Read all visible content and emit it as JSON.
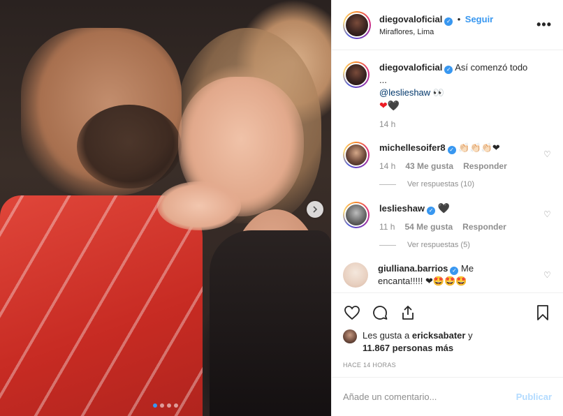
{
  "header": {
    "username": "diegovaloficial",
    "separator": "•",
    "follow_label": "Seguir",
    "location": "Miraflores, Lima",
    "more_label": "•••"
  },
  "caption": {
    "username": "diegovaloficial",
    "text": "Así comenzó todo ...",
    "mention": "@leslieshaw",
    "eyes": "👀",
    "hearts": [
      "❤",
      "🖤"
    ],
    "time": "14 h"
  },
  "comments": [
    {
      "username": "michellesoifer8",
      "emojis": "👏🏻👏🏻👏🏻❤",
      "time": "14 h",
      "likes": "43 Me gusta",
      "reply_label": "Responder",
      "replies": "Ver respuestas (10)"
    },
    {
      "username": "leslieshaw",
      "emojis": "🖤",
      "time": "11 h",
      "likes": "54 Me gusta",
      "reply_label": "Responder",
      "replies": "Ver respuestas (5)"
    },
    {
      "username": "giulliana.barrios",
      "text_1": "Me",
      "text_2": "encanta!!!!!",
      "emojis": "❤🤩🤩🤩"
    }
  ],
  "likes": {
    "prefix": "Les gusta a",
    "user": "ericksabater",
    "conj": "y",
    "count": "11.867 personas más"
  },
  "post_time": "HACE 14 HORAS",
  "add_comment": {
    "placeholder": "Añade un comentario...",
    "publish_label": "Publicar"
  },
  "carousel": {
    "total_dots": 4,
    "active_dot": 0
  },
  "colors": {
    "accent": "#3897f0",
    "publish_disabled": "#b3dbff",
    "muted": "#8e8e8e"
  },
  "icons": [
    "heart-icon",
    "comment-icon",
    "share-icon",
    "bookmark-icon",
    "chevron-right-icon",
    "more-icon",
    "verified-icon"
  ]
}
